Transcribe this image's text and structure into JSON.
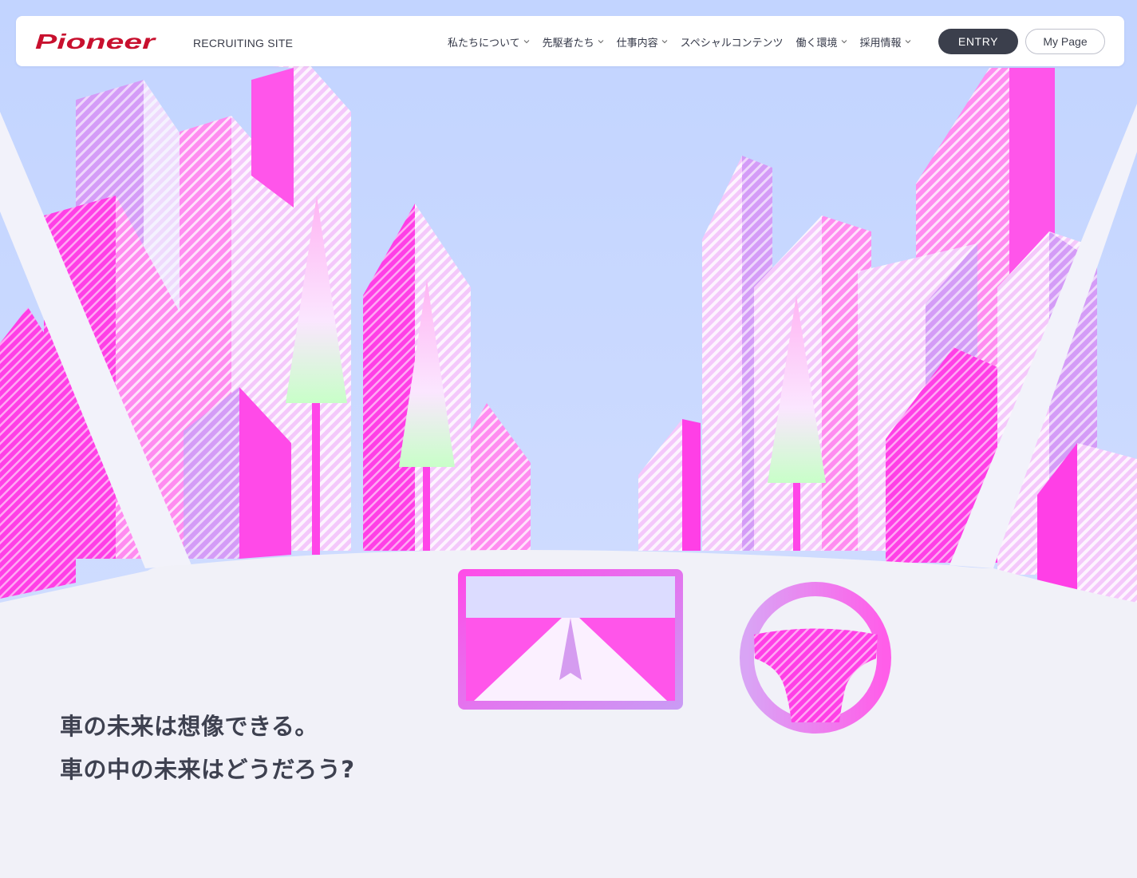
{
  "header": {
    "logo_text": "Pioneer",
    "site_label": "RECRUITING SITE",
    "nav": [
      {
        "label": "私たちについて"
      },
      {
        "label": "先駆者たち"
      },
      {
        "label": "仕事内容"
      },
      {
        "label": "スペシャルコンテンツ"
      },
      {
        "label": "働く環境"
      },
      {
        "label": "採用情報"
      }
    ],
    "entry_label": "ENTRY",
    "mypage_label": "My Page"
  },
  "hero": {
    "line1": "車の未来は想像できる。",
    "line2": "車の中の未来はどうだろう?"
  },
  "colors": {
    "brand_red": "#c8102e",
    "sky": "#c5d6ff",
    "magenta": "#ff3fe6",
    "lavender": "#c99cf5",
    "dashboard": "#f1f1f8",
    "dark_button": "#3b3f4c"
  }
}
